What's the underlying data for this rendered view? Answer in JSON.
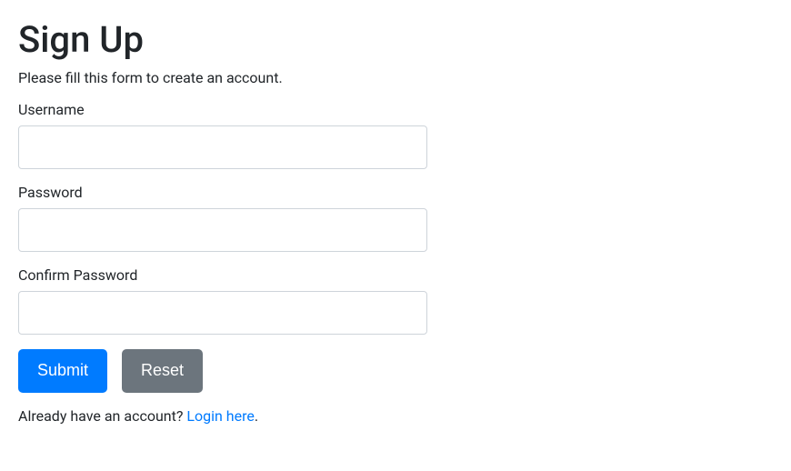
{
  "heading": "Sign Up",
  "subtitle": "Please fill this form to create an account.",
  "fields": {
    "username": {
      "label": "Username",
      "value": ""
    },
    "password": {
      "label": "Password",
      "value": ""
    },
    "confirm_password": {
      "label": "Confirm Password",
      "value": ""
    }
  },
  "buttons": {
    "submit_label": "Submit",
    "reset_label": "Reset"
  },
  "footer": {
    "prefix": "Already have an account? ",
    "link_text": "Login here",
    "suffix": "."
  }
}
